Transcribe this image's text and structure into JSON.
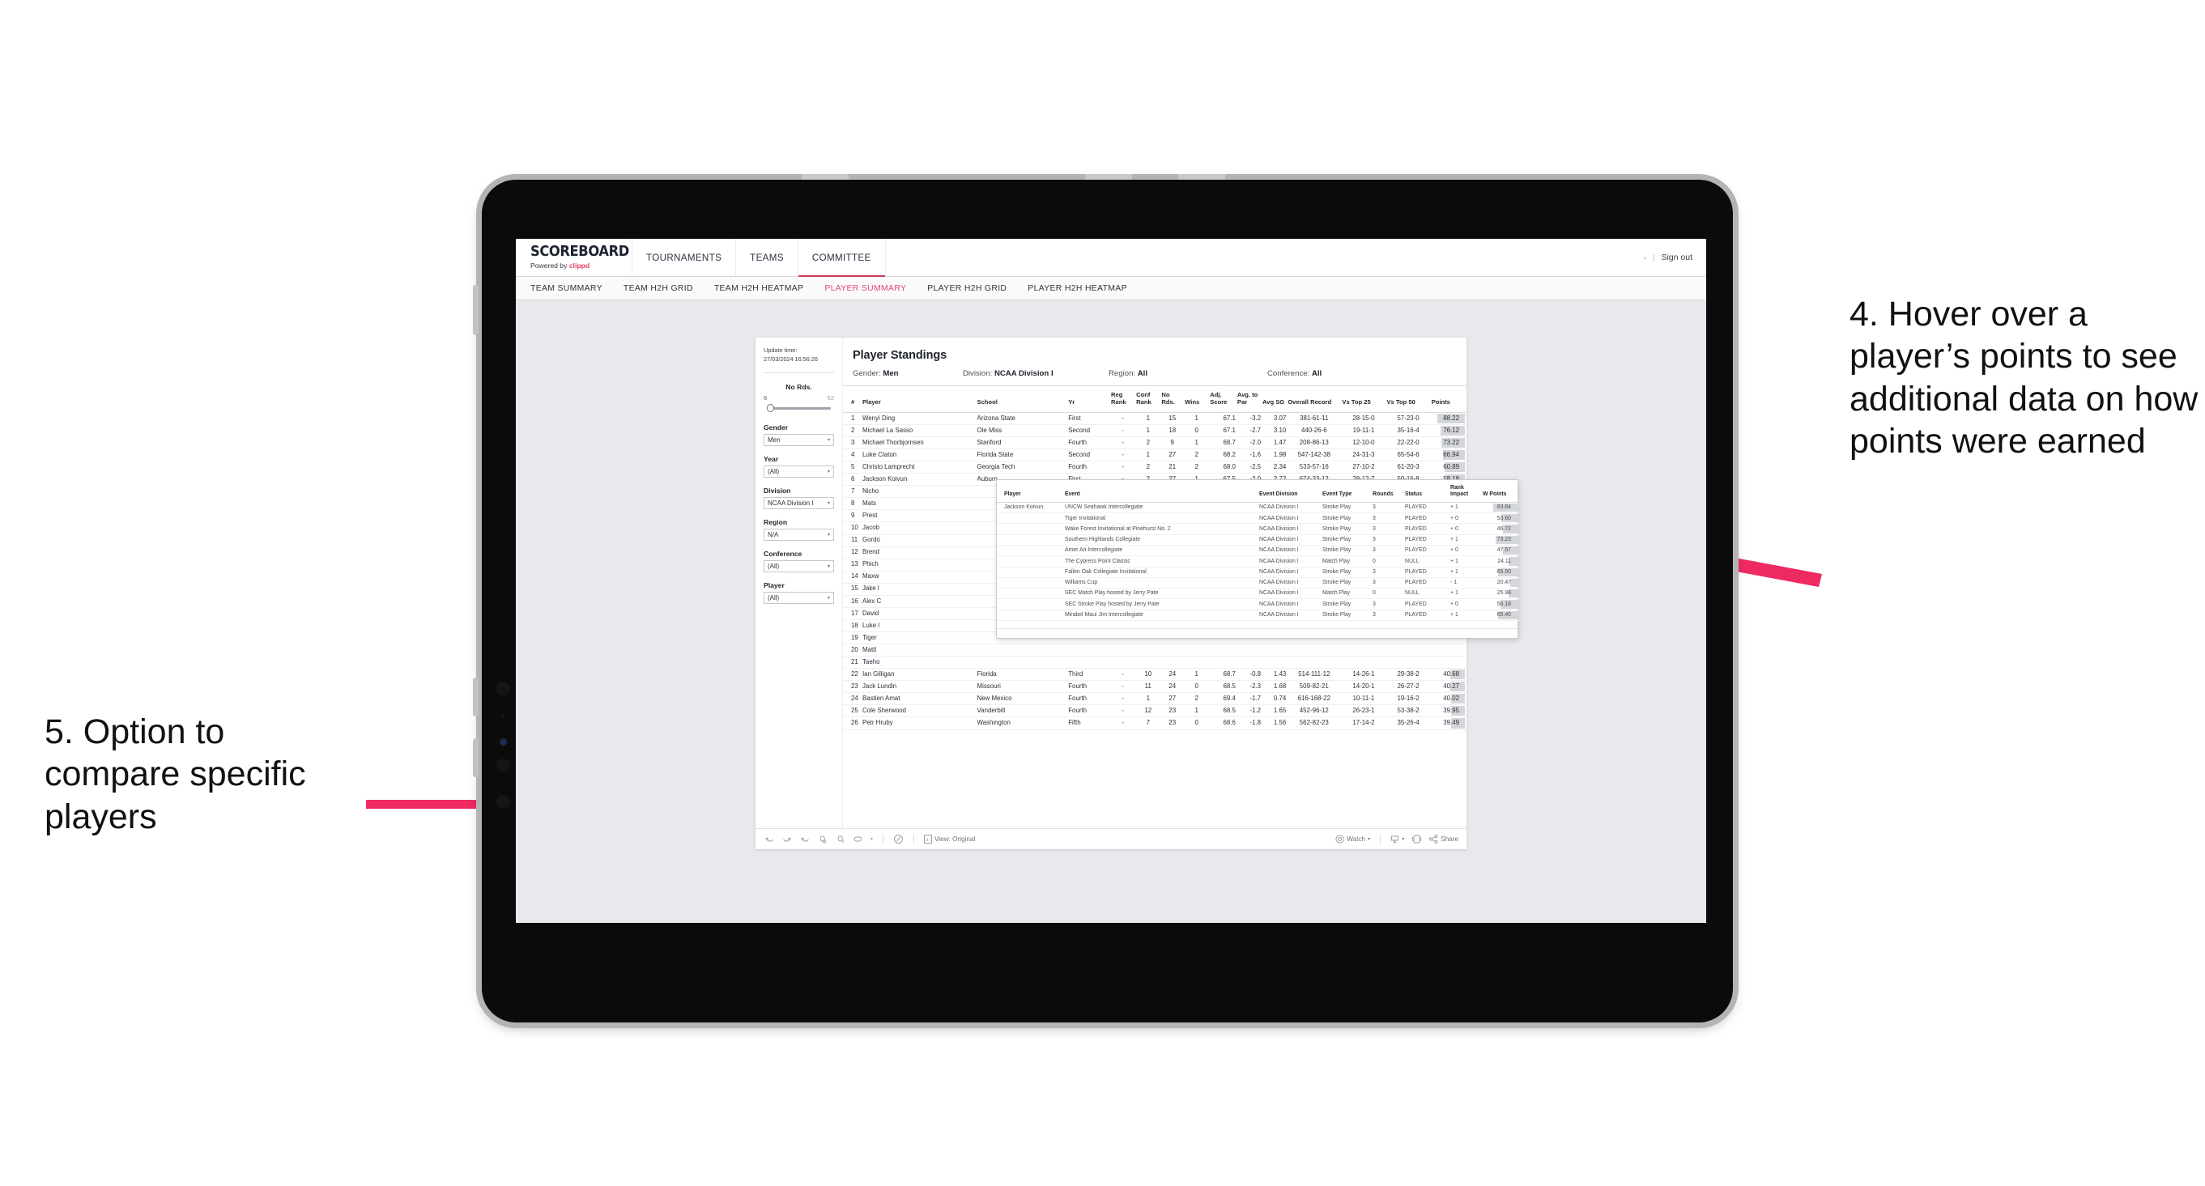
{
  "app": {
    "brand_title": "SCOREBOARD",
    "brand_sub_prefix": "Powered by ",
    "brand_sub_accent": "clippd",
    "topnav": [
      {
        "label": "TOURNAMENTS",
        "active": false
      },
      {
        "label": "TEAMS",
        "active": false
      },
      {
        "label": "COMMITTEE",
        "active": true
      }
    ],
    "user_caret": "›",
    "divider": "|",
    "signout": "Sign out",
    "subnav": [
      {
        "label": "TEAM SUMMARY",
        "active": false
      },
      {
        "label": "TEAM H2H GRID",
        "active": false
      },
      {
        "label": "TEAM H2H HEATMAP",
        "active": false
      },
      {
        "label": "PLAYER SUMMARY",
        "active": true
      },
      {
        "label": "PLAYER H2H GRID",
        "active": false
      },
      {
        "label": "PLAYER H2H HEATMAP",
        "active": false
      }
    ]
  },
  "filters": {
    "update_time_label": "Update time:",
    "update_time_value": "27/03/2024 16:56:26",
    "slider": {
      "title": "No Rds.",
      "min": "6",
      "max": "52",
      "value": 6
    },
    "dropdowns": [
      {
        "label": "Gender",
        "value": "Men"
      },
      {
        "label": "Year",
        "value": "(All)"
      },
      {
        "label": "Division",
        "value": "NCAA Division I"
      },
      {
        "label": "Region",
        "value": "N/A"
      },
      {
        "label": "Conference",
        "value": "(All)"
      },
      {
        "label": "Player",
        "value": "(All)"
      }
    ],
    "caret": "▾"
  },
  "viz": {
    "title": "Player Standings",
    "summary": [
      {
        "label": "Gender:",
        "value": "Men"
      },
      {
        "label": "Division:",
        "value": "NCAA Division I"
      },
      {
        "label": "Region:",
        "value": "All"
      },
      {
        "label": "Conference:",
        "value": "All"
      }
    ],
    "columns": [
      "#",
      "Player",
      "School",
      "Yr",
      "Reg Rank",
      "Conf Rank",
      "No Rds.",
      "Wins",
      "Adj. Score",
      "Avg. to Par",
      "Avg SG",
      "Overall Record",
      "Vs Top 25",
      "Vs Top 50",
      "Points"
    ],
    "rows": [
      {
        "n": "1",
        "player": "Wenyi Ding",
        "school": "Arizona State",
        "yr": "First",
        "reg": "-",
        "conf": "1",
        "rds": "15",
        "wins": "1",
        "adj": "67.1",
        "par": "-3.2",
        "sg": "3.07",
        "rec": "381-61-11",
        "t25": "28-15-0",
        "t50": "57-23-0",
        "pts": "88.22",
        "bar": 100
      },
      {
        "n": "2",
        "player": "Michael La Sasso",
        "school": "Ole Miss",
        "yr": "Second",
        "reg": "-",
        "conf": "1",
        "rds": "18",
        "wins": "0",
        "adj": "67.1",
        "par": "-2.7",
        "sg": "3.10",
        "rec": "440-26-6",
        "t25": "19-11-1",
        "t50": "35-16-4",
        "pts": "76.12",
        "bar": 86
      },
      {
        "n": "3",
        "player": "Michael Thorbjornsen",
        "school": "Stanford",
        "yr": "Fourth",
        "reg": "-",
        "conf": "2",
        "rds": "9",
        "wins": "1",
        "adj": "68.7",
        "par": "-2.0",
        "sg": "1.47",
        "rec": "208-86-13",
        "t25": "12-10-0",
        "t50": "22-22-0",
        "pts": "73.22",
        "bar": 83
      },
      {
        "n": "4",
        "player": "Luke Claton",
        "school": "Florida State",
        "yr": "Second",
        "reg": "-",
        "conf": "1",
        "rds": "27",
        "wins": "2",
        "adj": "68.2",
        "par": "-1.6",
        "sg": "1.98",
        "rec": "547-142-38",
        "t25": "24-31-3",
        "t50": "65-54-6",
        "pts": "66.94",
        "bar": 76
      },
      {
        "n": "5",
        "player": "Christo Lamprecht",
        "school": "Georgia Tech",
        "yr": "Fourth",
        "reg": "-",
        "conf": "2",
        "rds": "21",
        "wins": "2",
        "adj": "68.0",
        "par": "-2.5",
        "sg": "2.34",
        "rec": "533-57-16",
        "t25": "27-10-2",
        "t50": "61-20-3",
        "pts": "60.89",
        "bar": 69
      },
      {
        "n": "6",
        "player": "Jackson Koivun",
        "school": "Auburn",
        "yr": "First",
        "reg": "-",
        "conf": "2",
        "rds": "27",
        "wins": "1",
        "adj": "67.5",
        "par": "-2.0",
        "sg": "2.72",
        "rec": "674-33-12",
        "t25": "28-12-7",
        "t50": "50-16-8",
        "pts": "58.18",
        "bar": 66
      },
      {
        "n": "7",
        "player": "Nicho",
        "school": "",
        "yr": "",
        "reg": "",
        "conf": "",
        "rds": "",
        "wins": "",
        "adj": "",
        "par": "",
        "sg": "",
        "rec": "",
        "t25": "",
        "t50": "",
        "pts": "",
        "bar": 0
      },
      {
        "n": "8",
        "player": "Mats",
        "school": "",
        "yr": "",
        "reg": "",
        "conf": "",
        "rds": "",
        "wins": "",
        "adj": "",
        "par": "",
        "sg": "",
        "rec": "",
        "t25": "",
        "t50": "",
        "pts": "",
        "bar": 0
      },
      {
        "n": "9",
        "player": "Prest",
        "school": "",
        "yr": "",
        "reg": "",
        "conf": "",
        "rds": "",
        "wins": "",
        "adj": "",
        "par": "",
        "sg": "",
        "rec": "",
        "t25": "",
        "t50": "",
        "pts": "",
        "bar": 0
      },
      {
        "n": "10",
        "player": "Jacob",
        "school": "",
        "yr": "",
        "reg": "",
        "conf": "",
        "rds": "",
        "wins": "",
        "adj": "",
        "par": "",
        "sg": "",
        "rec": "",
        "t25": "",
        "t50": "",
        "pts": "",
        "bar": 0
      },
      {
        "n": "11",
        "player": "Gordo",
        "school": "",
        "yr": "",
        "reg": "",
        "conf": "",
        "rds": "",
        "wins": "",
        "adj": "",
        "par": "",
        "sg": "",
        "rec": "",
        "t25": "",
        "t50": "",
        "pts": "",
        "bar": 0
      },
      {
        "n": "12",
        "player": "Brend",
        "school": "",
        "yr": "",
        "reg": "",
        "conf": "",
        "rds": "",
        "wins": "",
        "adj": "",
        "par": "",
        "sg": "",
        "rec": "",
        "t25": "",
        "t50": "",
        "pts": "",
        "bar": 0
      },
      {
        "n": "13",
        "player": "Phich",
        "school": "",
        "yr": "",
        "reg": "",
        "conf": "",
        "rds": "",
        "wins": "",
        "adj": "",
        "par": "",
        "sg": "",
        "rec": "",
        "t25": "",
        "t50": "",
        "pts": "",
        "bar": 0
      },
      {
        "n": "14",
        "player": "Maxw",
        "school": "",
        "yr": "",
        "reg": "",
        "conf": "",
        "rds": "",
        "wins": "",
        "adj": "",
        "par": "",
        "sg": "",
        "rec": "",
        "t25": "",
        "t50": "",
        "pts": "",
        "bar": 0
      },
      {
        "n": "15",
        "player": "Jake l",
        "school": "",
        "yr": "",
        "reg": "",
        "conf": "",
        "rds": "",
        "wins": "",
        "adj": "",
        "par": "",
        "sg": "",
        "rec": "",
        "t25": "",
        "t50": "",
        "pts": "",
        "bar": 0
      },
      {
        "n": "16",
        "player": "Alex C",
        "school": "",
        "yr": "",
        "reg": "",
        "conf": "",
        "rds": "",
        "wins": "",
        "adj": "",
        "par": "",
        "sg": "",
        "rec": "",
        "t25": "",
        "t50": "",
        "pts": "",
        "bar": 0
      },
      {
        "n": "17",
        "player": "David",
        "school": "",
        "yr": "",
        "reg": "",
        "conf": "",
        "rds": "",
        "wins": "",
        "adj": "",
        "par": "",
        "sg": "",
        "rec": "",
        "t25": "",
        "t50": "",
        "pts": "",
        "bar": 0
      },
      {
        "n": "18",
        "player": "Luke l",
        "school": "",
        "yr": "",
        "reg": "",
        "conf": "",
        "rds": "",
        "wins": "",
        "adj": "",
        "par": "",
        "sg": "",
        "rec": "",
        "t25": "",
        "t50": "",
        "pts": "",
        "bar": 0
      },
      {
        "n": "19",
        "player": "Tiger",
        "school": "",
        "yr": "",
        "reg": "",
        "conf": "",
        "rds": "",
        "wins": "",
        "adj": "",
        "par": "",
        "sg": "",
        "rec": "",
        "t25": "",
        "t50": "",
        "pts": "",
        "bar": 0
      },
      {
        "n": "20",
        "player": "Mattl",
        "school": "",
        "yr": "",
        "reg": "",
        "conf": "",
        "rds": "",
        "wins": "",
        "adj": "",
        "par": "",
        "sg": "",
        "rec": "",
        "t25": "",
        "t50": "",
        "pts": "",
        "bar": 0
      },
      {
        "n": "21",
        "player": "Taeho",
        "school": "",
        "yr": "",
        "reg": "",
        "conf": "",
        "rds": "",
        "wins": "",
        "adj": "",
        "par": "",
        "sg": "",
        "rec": "",
        "t25": "",
        "t50": "",
        "pts": "",
        "bar": 0
      },
      {
        "n": "22",
        "player": "Ian Gilligan",
        "school": "Florida",
        "yr": "Third",
        "reg": "-",
        "conf": "10",
        "rds": "24",
        "wins": "1",
        "adj": "68.7",
        "par": "-0.8",
        "sg": "1.43",
        "rec": "514-111-12",
        "t25": "14-26-1",
        "t50": "29-38-2",
        "pts": "40.68",
        "bar": 46
      },
      {
        "n": "23",
        "player": "Jack Lundin",
        "school": "Missouri",
        "yr": "Fourth",
        "reg": "-",
        "conf": "11",
        "rds": "24",
        "wins": "0",
        "adj": "68.5",
        "par": "-2.3",
        "sg": "1.68",
        "rec": "509-82-21",
        "t25": "14-20-1",
        "t50": "26-27-2",
        "pts": "40.27",
        "bar": 46
      },
      {
        "n": "24",
        "player": "Bastien Amat",
        "school": "New Mexico",
        "yr": "Fourth",
        "reg": "-",
        "conf": "1",
        "rds": "27",
        "wins": "2",
        "adj": "69.4",
        "par": "-1.7",
        "sg": "0.74",
        "rec": "616-168-22",
        "t25": "10-11-1",
        "t50": "19-16-2",
        "pts": "40.02",
        "bar": 45
      },
      {
        "n": "25",
        "player": "Cole Sherwood",
        "school": "Vanderbilt",
        "yr": "Fourth",
        "reg": "-",
        "conf": "12",
        "rds": "23",
        "wins": "1",
        "adj": "68.5",
        "par": "-1.2",
        "sg": "1.65",
        "rec": "452-96-12",
        "t25": "26-23-1",
        "t50": "53-38-2",
        "pts": "39.95",
        "bar": 45
      },
      {
        "n": "26",
        "player": "Petr Hruby",
        "school": "Washington",
        "yr": "Fifth",
        "reg": "-",
        "conf": "7",
        "rds": "23",
        "wins": "0",
        "adj": "68.6",
        "par": "-1.8",
        "sg": "1.56",
        "rec": "562-82-23",
        "t25": "17-14-2",
        "t50": "35-26-4",
        "pts": "39.49",
        "bar": 45
      }
    ]
  },
  "tooltip": {
    "columns": [
      "Player",
      "Event",
      "Event Division",
      "Event Type",
      "Rounds",
      "Status",
      "Rank Impact",
      "W Points"
    ],
    "player": "Jackson Koivun",
    "rows": [
      {
        "event": "UNCW Seahawk Intercollegiate",
        "division": "NCAA Division I",
        "type": "Stroke Play",
        "rounds": "3",
        "status": "PLAYED",
        "impact": "+ 1",
        "wpts": "83.64",
        "bar": 100
      },
      {
        "event": "Tiger Invitational",
        "division": "NCAA Division I",
        "type": "Stroke Play",
        "rounds": "3",
        "status": "PLAYED",
        "impact": "+ 0",
        "wpts": "53.60",
        "bar": 64
      },
      {
        "event": "Wake Forest Invitational at Pinehurst No. 2",
        "division": "NCAA Division I",
        "type": "Stroke Play",
        "rounds": "3",
        "status": "PLAYED",
        "impact": "+ 0",
        "wpts": "46.72",
        "bar": 56
      },
      {
        "event": "Southern Highlands Collegiate",
        "division": "NCAA Division I",
        "type": "Stroke Play",
        "rounds": "3",
        "status": "PLAYED",
        "impact": "+ 1",
        "wpts": "73.23",
        "bar": 88
      },
      {
        "event": "Amer Ari Intercollegiate",
        "division": "NCAA Division I",
        "type": "Stroke Play",
        "rounds": "3",
        "status": "PLAYED",
        "impact": "+ 0",
        "wpts": "47.57",
        "bar": 57
      },
      {
        "event": "The Cypress Point Classic",
        "division": "NCAA Division I",
        "type": "Match Play",
        "rounds": "0",
        "status": "NULL",
        "impact": "+ 1",
        "wpts": "24.11",
        "bar": 29
      },
      {
        "event": "Fallen Oak Collegiate Invitational",
        "division": "NCAA Division I",
        "type": "Stroke Play",
        "rounds": "3",
        "status": "PLAYED",
        "impact": "+ 1",
        "wpts": "65.50",
        "bar": 78
      },
      {
        "event": "Williams Cup",
        "division": "NCAA Division I",
        "type": "Stroke Play",
        "rounds": "3",
        "status": "PLAYED",
        "impact": "- 1",
        "wpts": "20.47",
        "bar": 24
      },
      {
        "event": "SEC Match Play hosted by Jerry Pate",
        "division": "NCAA Division I",
        "type": "Match Play",
        "rounds": "0",
        "status": "NULL",
        "impact": "+ 1",
        "wpts": "25.98",
        "bar": 31
      },
      {
        "event": "SEC Stroke Play hosted by Jerry Pate",
        "division": "NCAA Division I",
        "type": "Stroke Play",
        "rounds": "3",
        "status": "PLAYED",
        "impact": "+ 0",
        "wpts": "56.18",
        "bar": 67
      },
      {
        "event": "Mirabel Maui Jim Intercollegiate",
        "division": "NCAA Division I",
        "type": "Stroke Play",
        "rounds": "3",
        "status": "PLAYED",
        "impact": "+ 1",
        "wpts": "65.40",
        "bar": 78
      }
    ]
  },
  "toolbar": {
    "view_label": "View: Original",
    "watch_label": "Watch",
    "share_label": "Share",
    "caret": "▾"
  },
  "annotations": {
    "right": "4. Hover over a player’s points to see additional data on how points were earned",
    "left": "5. Option to compare specific players",
    "accent_color": "#ee2a62"
  }
}
